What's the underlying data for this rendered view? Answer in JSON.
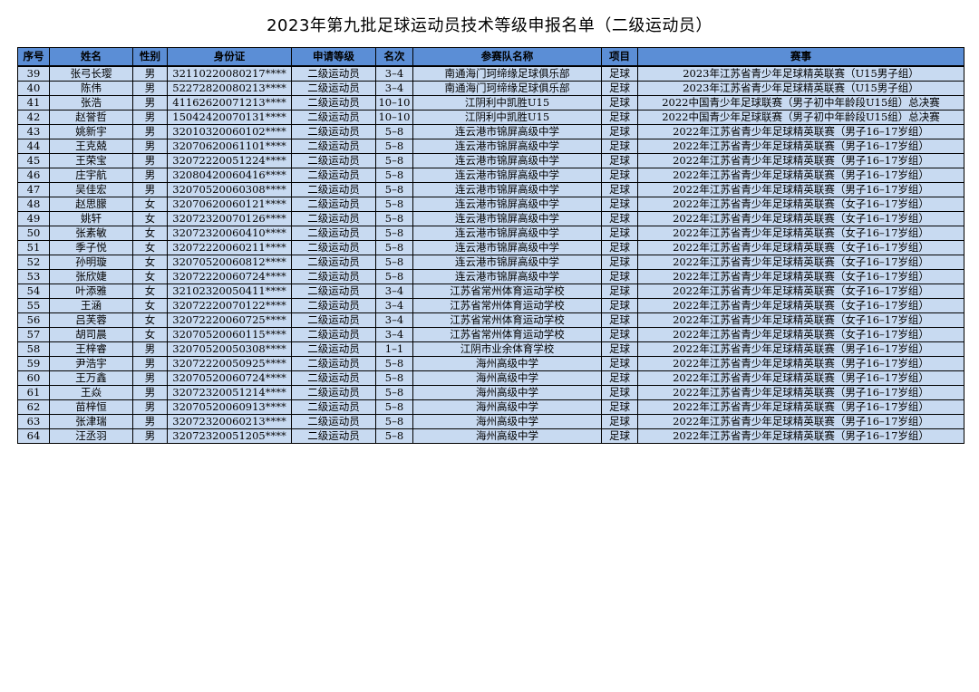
{
  "title": "2023年第九批足球运动员技术等级申报名单（二级运动员）",
  "colors": {
    "header_bg": "#5b8ed6",
    "row_bg": "#c8daf1"
  },
  "columns": [
    "序号",
    "姓名",
    "性别",
    "身份证",
    "申请等级",
    "名次",
    "参赛队名称",
    "项目",
    "赛事"
  ],
  "rows": [
    [
      "39",
      "张弓长璎",
      "男",
      "32110220080217****",
      "二级运动员",
      "3–4",
      "南通海门珂缔缘足球俱乐部",
      "足球",
      "2023年江苏省青少年足球精英联赛（U15男子组）"
    ],
    [
      "40",
      "陈伟",
      "男",
      "52272820080213****",
      "二级运动员",
      "3–4",
      "南通海门珂缔缘足球俱乐部",
      "足球",
      "2023年江苏省青少年足球精英联赛（U15男子组）"
    ],
    [
      "41",
      "张浩",
      "男",
      "41162620071213****",
      "二级运动员",
      "10–10",
      "江阴利中凯胜U15",
      "足球",
      "2022中国青少年足球联赛（男子初中年龄段U15组）总决赛"
    ],
    [
      "42",
      "赵誉哲",
      "男",
      "15042420070131****",
      "二级运动员",
      "10–10",
      "江阴利中凯胜U15",
      "足球",
      "2022中国青少年足球联赛（男子初中年龄段U15组）总决赛"
    ],
    [
      "43",
      "姚新宇",
      "男",
      "32010320060102****",
      "二级运动员",
      "5–8",
      "连云港市锦屏高级中学",
      "足球",
      "2022年江苏省青少年足球精英联赛（男子16–17岁组）"
    ],
    [
      "44",
      "王克兢",
      "男",
      "32070620061101****",
      "二级运动员",
      "5–8",
      "连云港市锦屏高级中学",
      "足球",
      "2022年江苏省青少年足球精英联赛（男子16–17岁组）"
    ],
    [
      "45",
      "王荣宝",
      "男",
      "32072220051224****",
      "二级运动员",
      "5–8",
      "连云港市锦屏高级中学",
      "足球",
      "2022年江苏省青少年足球精英联赛（男子16–17岁组）"
    ],
    [
      "46",
      "庄宇航",
      "男",
      "32080420060416****",
      "二级运动员",
      "5–8",
      "连云港市锦屏高级中学",
      "足球",
      "2022年江苏省青少年足球精英联赛（男子16–17岁组）"
    ],
    [
      "47",
      "吴佳宏",
      "男",
      "32070520060308****",
      "二级运动员",
      "5–8",
      "连云港市锦屏高级中学",
      "足球",
      "2022年江苏省青少年足球精英联赛（男子16–17岁组）"
    ],
    [
      "48",
      "赵思朦",
      "女",
      "32070620060121****",
      "二级运动员",
      "5–8",
      "连云港市锦屏高级中学",
      "足球",
      "2022年江苏省青少年足球精英联赛（女子16–17岁组）"
    ],
    [
      "49",
      "姚轩",
      "女",
      "32072320070126****",
      "二级运动员",
      "5–8",
      "连云港市锦屏高级中学",
      "足球",
      "2022年江苏省青少年足球精英联赛（女子16–17岁组）"
    ],
    [
      "50",
      "张素敏",
      "女",
      "32072320060410****",
      "二级运动员",
      "5–8",
      "连云港市锦屏高级中学",
      "足球",
      "2022年江苏省青少年足球精英联赛（女子16–17岁组）"
    ],
    [
      "51",
      "季子悦",
      "女",
      "32072220060211****",
      "二级运动员",
      "5–8",
      "连云港市锦屏高级中学",
      "足球",
      "2022年江苏省青少年足球精英联赛（女子16–17岁组）"
    ],
    [
      "52",
      "孙明璇",
      "女",
      "32070520060812****",
      "二级运动员",
      "5–8",
      "连云港市锦屏高级中学",
      "足球",
      "2022年江苏省青少年足球精英联赛（女子16–17岁组）"
    ],
    [
      "53",
      "张欣婕",
      "女",
      "32072220060724****",
      "二级运动员",
      "5–8",
      "连云港市锦屏高级中学",
      "足球",
      "2022年江苏省青少年足球精英联赛（女子16–17岁组）"
    ],
    [
      "54",
      "叶添雅",
      "女",
      "32102320050411****",
      "二级运动员",
      "3–4",
      "江苏省常州体育运动学校",
      "足球",
      "2022年江苏省青少年足球精英联赛（女子16–17岁组）"
    ],
    [
      "55",
      "王涵",
      "女",
      "32072220070122****",
      "二级运动员",
      "3–4",
      "江苏省常州体育运动学校",
      "足球",
      "2022年江苏省青少年足球精英联赛（女子16–17岁组）"
    ],
    [
      "56",
      "吕芙蓉",
      "女",
      "32072220060725****",
      "二级运动员",
      "3–4",
      "江苏省常州体育运动学校",
      "足球",
      "2022年江苏省青少年足球精英联赛（女子16–17岁组）"
    ],
    [
      "57",
      "胡司晨",
      "女",
      "32070520060115****",
      "二级运动员",
      "3–4",
      "江苏省常州体育运动学校",
      "足球",
      "2022年江苏省青少年足球精英联赛（女子16–17岁组）"
    ],
    [
      "58",
      "王梓睿",
      "男",
      "32070520050308****",
      "二级运动员",
      "1–1",
      "江阴市业余体育学校",
      "足球",
      "2022年江苏省青少年足球精英联赛（男子16–17岁组）"
    ],
    [
      "59",
      "尹浩宇",
      "男",
      "32072220050925****",
      "二级运动员",
      "5–8",
      "海州高级中学",
      "足球",
      "2022年江苏省青少年足球精英联赛（男子16–17岁组）"
    ],
    [
      "60",
      "王万鑫",
      "男",
      "32070520060724****",
      "二级运动员",
      "5–8",
      "海州高级中学",
      "足球",
      "2022年江苏省青少年足球精英联赛（男子16–17岁组）"
    ],
    [
      "61",
      "王焱",
      "男",
      "32072320051214****",
      "二级运动员",
      "5–8",
      "海州高级中学",
      "足球",
      "2022年江苏省青少年足球精英联赛（男子16–17岁组）"
    ],
    [
      "62",
      "苗梓恒",
      "男",
      "32070520060913****",
      "二级运动员",
      "5–8",
      "海州高级中学",
      "足球",
      "2022年江苏省青少年足球精英联赛（男子16–17岁组）"
    ],
    [
      "63",
      "张津瑞",
      "男",
      "32072320060213****",
      "二级运动员",
      "5–8",
      "海州高级中学",
      "足球",
      "2022年江苏省青少年足球精英联赛（男子16–17岁组）"
    ],
    [
      "64",
      "汪丞羽",
      "男",
      "32072320051205****",
      "二级运动员",
      "5–8",
      "海州高级中学",
      "足球",
      "2022年江苏省青少年足球精英联赛（男子16–17岁组）"
    ]
  ]
}
